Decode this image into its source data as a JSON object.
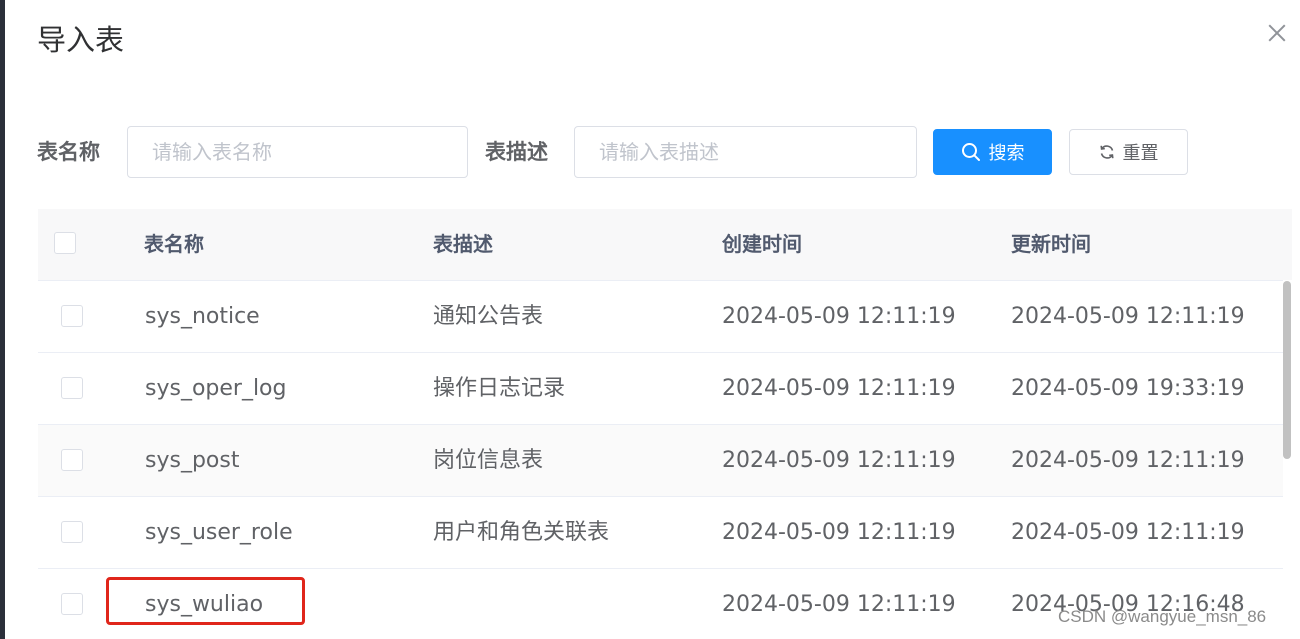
{
  "dialog": {
    "title": "导入表"
  },
  "search_form": {
    "table_name_label": "表名称",
    "table_name_placeholder": "请输入表名称",
    "table_name_value": "",
    "table_desc_label": "表描述",
    "table_desc_placeholder": "请输入表描述",
    "table_desc_value": "",
    "search_button_label": "搜索",
    "reset_button_label": "重置"
  },
  "table": {
    "columns": [
      "表名称",
      "表描述",
      "创建时间",
      "更新时间"
    ],
    "rows": [
      {
        "name": "sys_notice",
        "desc": "通知公告表",
        "created": "2024-05-09 12:11:19",
        "updated": "2024-05-09 12:11:19",
        "checked": false
      },
      {
        "name": "sys_oper_log",
        "desc": "操作日志记录",
        "created": "2024-05-09 12:11:19",
        "updated": "2024-05-09 19:33:19",
        "checked": false
      },
      {
        "name": "sys_post",
        "desc": "岗位信息表",
        "created": "2024-05-09 12:11:19",
        "updated": "2024-05-09 12:11:19",
        "checked": false
      },
      {
        "name": "sys_user_role",
        "desc": "用户和角色关联表",
        "created": "2024-05-09 12:11:19",
        "updated": "2024-05-09 12:11:19",
        "checked": false
      },
      {
        "name": "sys_wuliao",
        "desc": "",
        "created": "2024-05-09 12:11:19",
        "updated": "2024-05-09 12:16:48",
        "checked": false
      }
    ]
  },
  "watermark": "CSDN @wangyue_msn_86",
  "icons": {
    "close": "close-icon",
    "search": "search-icon",
    "reset": "refresh-icon"
  },
  "colors": {
    "primary": "#1890ff",
    "highlight": "#e0261b",
    "header_bg": "#f8f8f9"
  }
}
